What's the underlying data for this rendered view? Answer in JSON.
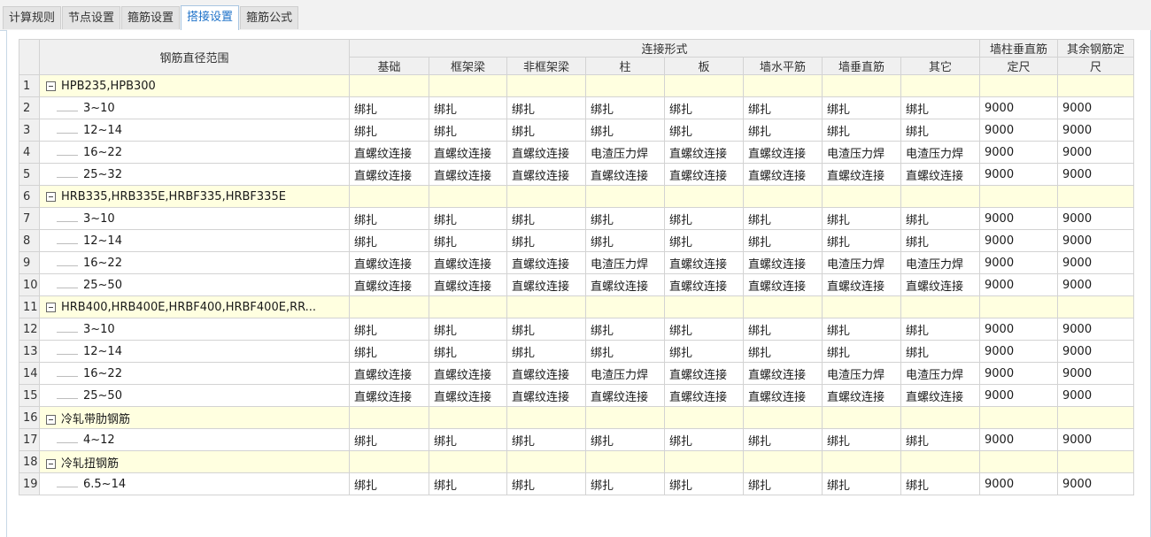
{
  "tabs": [
    {
      "label": "计算规则",
      "active": false
    },
    {
      "label": "节点设置",
      "active": false
    },
    {
      "label": "箍筋设置",
      "active": false
    },
    {
      "label": "搭接设置",
      "active": true
    },
    {
      "label": "箍筋公式",
      "active": false
    }
  ],
  "table": {
    "header": {
      "diameter_range": "钢筋直径范围",
      "connection_form": "连接形式",
      "connection_columns": [
        "基础",
        "框架梁",
        "非框架梁",
        "柱",
        "板",
        "墙水平筋",
        "墙垂直筋",
        "其它"
      ],
      "wall_col_fixed_line1": "墙柱垂直筋",
      "wall_col_fixed_line2": "定尺",
      "other_fixed_line1": "其余钢筋定",
      "other_fixed_line2": "尺"
    },
    "rows": [
      {
        "no": "1",
        "type": "group",
        "label": "HPB235,HPB300"
      },
      {
        "no": "2",
        "type": "item",
        "label": "3~10",
        "values": [
          "绑扎",
          "绑扎",
          "绑扎",
          "绑扎",
          "绑扎",
          "绑扎",
          "绑扎",
          "绑扎",
          "9000",
          "9000"
        ]
      },
      {
        "no": "3",
        "type": "item",
        "label": "12~14",
        "values": [
          "绑扎",
          "绑扎",
          "绑扎",
          "绑扎",
          "绑扎",
          "绑扎",
          "绑扎",
          "绑扎",
          "9000",
          "9000"
        ]
      },
      {
        "no": "4",
        "type": "item",
        "label": "16~22",
        "values": [
          "直螺纹连接",
          "直螺纹连接",
          "直螺纹连接",
          "电渣压力焊",
          "直螺纹连接",
          "直螺纹连接",
          "电渣压力焊",
          "电渣压力焊",
          "9000",
          "9000"
        ]
      },
      {
        "no": "5",
        "type": "item",
        "label": "25~32",
        "values": [
          "直螺纹连接",
          "直螺纹连接",
          "直螺纹连接",
          "直螺纹连接",
          "直螺纹连接",
          "直螺纹连接",
          "直螺纹连接",
          "直螺纹连接",
          "9000",
          "9000"
        ]
      },
      {
        "no": "6",
        "type": "group",
        "label": "HRB335,HRB335E,HRBF335,HRBF335E"
      },
      {
        "no": "7",
        "type": "item",
        "label": "3~10",
        "values": [
          "绑扎",
          "绑扎",
          "绑扎",
          "绑扎",
          "绑扎",
          "绑扎",
          "绑扎",
          "绑扎",
          "9000",
          "9000"
        ]
      },
      {
        "no": "8",
        "type": "item",
        "label": "12~14",
        "values": [
          "绑扎",
          "绑扎",
          "绑扎",
          "绑扎",
          "绑扎",
          "绑扎",
          "绑扎",
          "绑扎",
          "9000",
          "9000"
        ]
      },
      {
        "no": "9",
        "type": "item",
        "label": "16~22",
        "values": [
          "直螺纹连接",
          "直螺纹连接",
          "直螺纹连接",
          "电渣压力焊",
          "直螺纹连接",
          "直螺纹连接",
          "电渣压力焊",
          "电渣压力焊",
          "9000",
          "9000"
        ]
      },
      {
        "no": "10",
        "type": "item",
        "label": "25~50",
        "values": [
          "直螺纹连接",
          "直螺纹连接",
          "直螺纹连接",
          "直螺纹连接",
          "直螺纹连接",
          "直螺纹连接",
          "直螺纹连接",
          "直螺纹连接",
          "9000",
          "9000"
        ]
      },
      {
        "no": "11",
        "type": "group",
        "label": "HRB400,HRB400E,HRBF400,HRBF400E,RR..."
      },
      {
        "no": "12",
        "type": "item",
        "label": "3~10",
        "values": [
          "绑扎",
          "绑扎",
          "绑扎",
          "绑扎",
          "绑扎",
          "绑扎",
          "绑扎",
          "绑扎",
          "9000",
          "9000"
        ]
      },
      {
        "no": "13",
        "type": "item",
        "label": "12~14",
        "values": [
          "绑扎",
          "绑扎",
          "绑扎",
          "绑扎",
          "绑扎",
          "绑扎",
          "绑扎",
          "绑扎",
          "9000",
          "9000"
        ]
      },
      {
        "no": "14",
        "type": "item",
        "label": "16~22",
        "values": [
          "直螺纹连接",
          "直螺纹连接",
          "直螺纹连接",
          "电渣压力焊",
          "直螺纹连接",
          "直螺纹连接",
          "电渣压力焊",
          "电渣压力焊",
          "9000",
          "9000"
        ]
      },
      {
        "no": "15",
        "type": "item",
        "label": "25~50",
        "values": [
          "直螺纹连接",
          "直螺纹连接",
          "直螺纹连接",
          "直螺纹连接",
          "直螺纹连接",
          "直螺纹连接",
          "直螺纹连接",
          "直螺纹连接",
          "9000",
          "9000"
        ]
      },
      {
        "no": "16",
        "type": "group",
        "label": "冷轧带肋钢筋"
      },
      {
        "no": "17",
        "type": "item",
        "label": "4~12",
        "values": [
          "绑扎",
          "绑扎",
          "绑扎",
          "绑扎",
          "绑扎",
          "绑扎",
          "绑扎",
          "绑扎",
          "9000",
          "9000"
        ]
      },
      {
        "no": "18",
        "type": "group",
        "label": "冷轧扭钢筋"
      },
      {
        "no": "19",
        "type": "item",
        "label": "6.5~14",
        "values": [
          "绑扎",
          "绑扎",
          "绑扎",
          "绑扎",
          "绑扎",
          "绑扎",
          "绑扎",
          "绑扎",
          "9000",
          "9000"
        ]
      }
    ]
  },
  "colors": {
    "group_row_bg": "#ffffe0",
    "active_tab_text": "#1e72c9",
    "header_bg": "#f0f0f0"
  },
  "icons": {
    "group_toggle": "collapse-minus-icon",
    "tree_branch": "tree-line-icon"
  }
}
